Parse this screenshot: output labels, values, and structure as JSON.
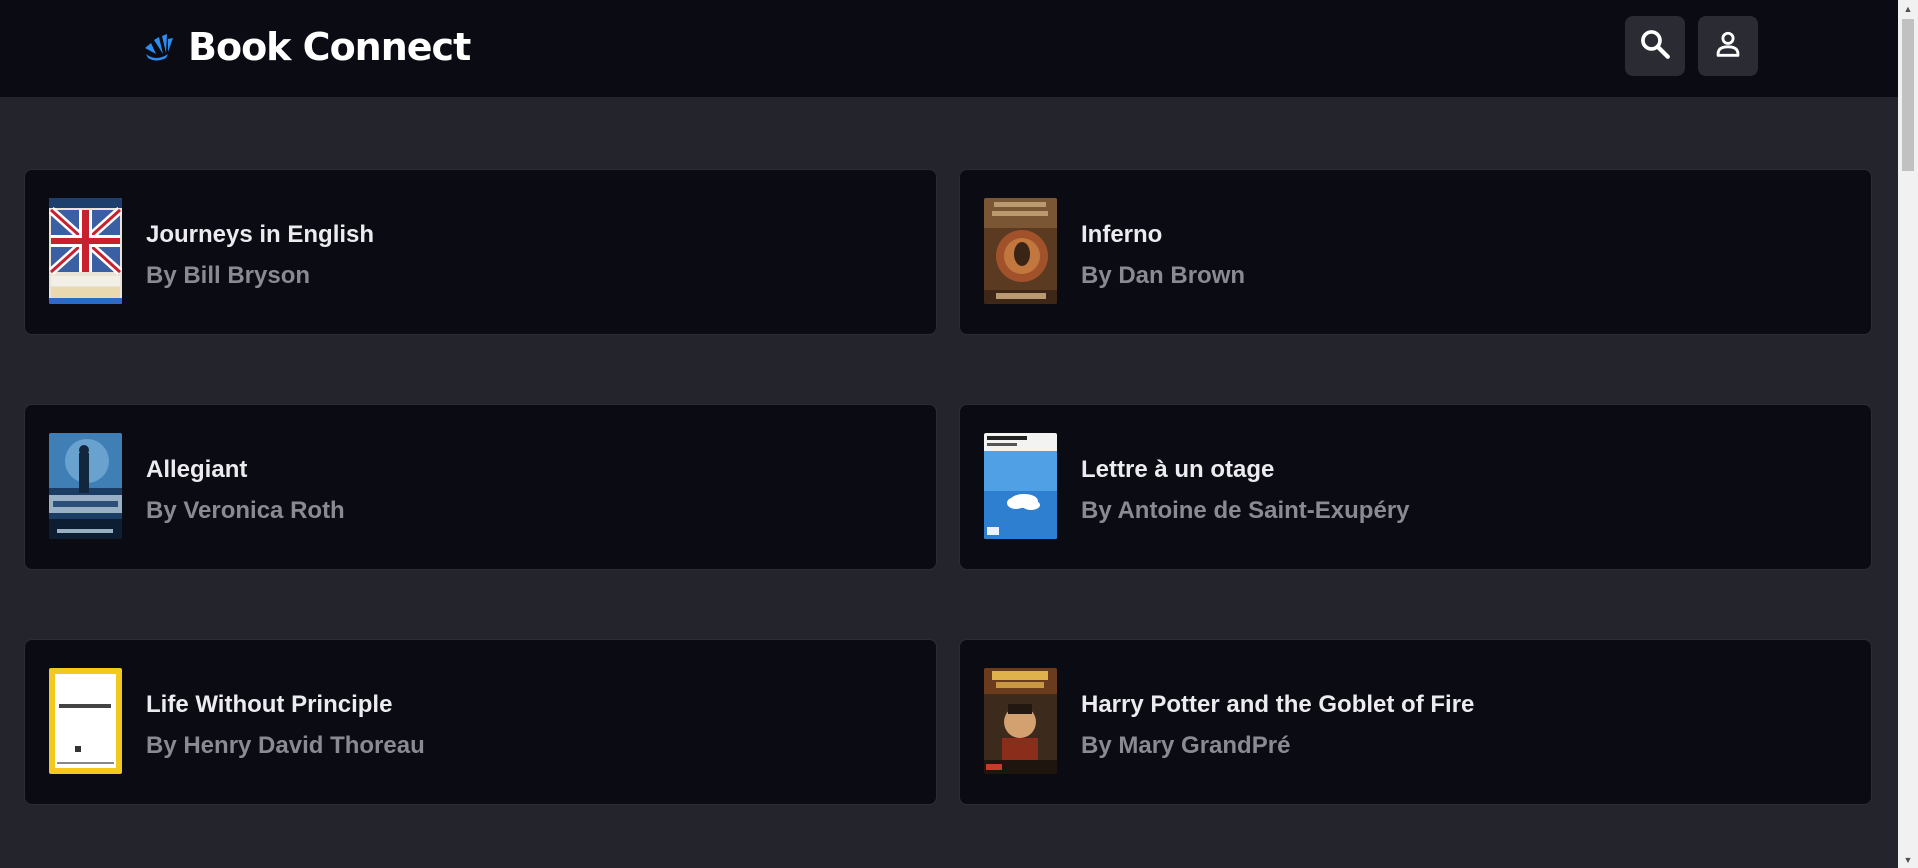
{
  "header": {
    "title": "Book Connect",
    "logo_icon": "hand-wave-logo",
    "search_icon": "search-icon",
    "account_icon": "account-icon"
  },
  "books": [
    {
      "title": "Journeys in English",
      "author": "By Bill Bryson",
      "cover_icon": "book-cover-image"
    },
    {
      "title": "Inferno",
      "author": "By Dan Brown",
      "cover_icon": "book-cover-image"
    },
    {
      "title": "Allegiant",
      "author": "By Veronica Roth",
      "cover_icon": "book-cover-image"
    },
    {
      "title": "Lettre à un otage",
      "author": "By Antoine de Saint-Exupéry",
      "cover_icon": "book-cover-image"
    },
    {
      "title": "Life Without Principle",
      "author": "By Henry David Thoreau",
      "cover_icon": "book-cover-image"
    },
    {
      "title": "Harry Potter and the Goblet of Fire",
      "author": "By Mary GrandPré",
      "cover_icon": "book-cover-image"
    }
  ],
  "colors": {
    "header_bg": "#0b0b13",
    "page_bg": "#24242c",
    "card_bg": "#0b0b13",
    "button_bg": "#2b2b34",
    "logo_accent": "#2f8cf0",
    "title_text": "#ececf0",
    "author_text": "#8a8a92"
  }
}
